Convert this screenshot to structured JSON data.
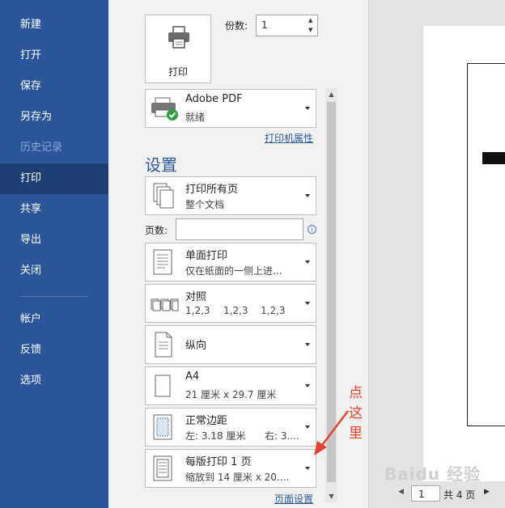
{
  "sidebar": {
    "items": [
      {
        "label": "新建",
        "state": "normal"
      },
      {
        "label": "打开",
        "state": "normal"
      },
      {
        "label": "保存",
        "state": "normal"
      },
      {
        "label": "另存为",
        "state": "normal"
      },
      {
        "label": "历史记录",
        "state": "disabled"
      },
      {
        "label": "打印",
        "state": "active"
      },
      {
        "label": "共享",
        "state": "normal"
      },
      {
        "label": "导出",
        "state": "normal"
      },
      {
        "label": "关闭",
        "state": "normal"
      },
      {
        "label": "帐户",
        "state": "normal"
      },
      {
        "label": "反馈",
        "state": "normal"
      },
      {
        "label": "选项",
        "state": "normal"
      }
    ]
  },
  "print": {
    "button_label": "打印",
    "copies_label": "份数:",
    "copies_value": "1"
  },
  "printer": {
    "name": "Adobe PDF",
    "status": "就绪",
    "properties_link": "打印机属性"
  },
  "settings": {
    "title": "设置",
    "pages_label": "页数:",
    "pages_value": "",
    "page_setup_link": "页面设置",
    "options": [
      {
        "line1": "打印所有页",
        "line2": "整个文档",
        "icon": "all-pages-icon"
      },
      {
        "line1": "单面打印",
        "line2": "仅在纸面的一侧上进...",
        "icon": "single-sided-icon"
      },
      {
        "line1": "对照",
        "line2a": "1,2,3",
        "line2b": "1,2,3",
        "line2c": "1,2,3",
        "icon": "collate-icon"
      },
      {
        "line1": "纵向",
        "icon": "portrait-icon"
      },
      {
        "line1": "A4",
        "line2": "21 厘米 x 29.7 厘米",
        "icon": "paper-size-icon"
      },
      {
        "line1": "正常边距",
        "line2a": "左: 3.18 厘米",
        "line2b": "右: 3....",
        "icon": "margins-icon"
      },
      {
        "line1": "每版打印 1 页",
        "line2": "缩放到 14 厘米 x 20....",
        "icon": "pages-per-sheet-icon"
      }
    ]
  },
  "annotation": {
    "text": "点这里",
    "color": "#e8402c"
  },
  "preview": {
    "page_current": "1",
    "page_total": "共 4 页"
  },
  "watermark": "Baidu 经验",
  "colors": {
    "sidebar_bg": "#2b579a",
    "sidebar_active": "#1e3f73",
    "accent": "#2b579a"
  }
}
